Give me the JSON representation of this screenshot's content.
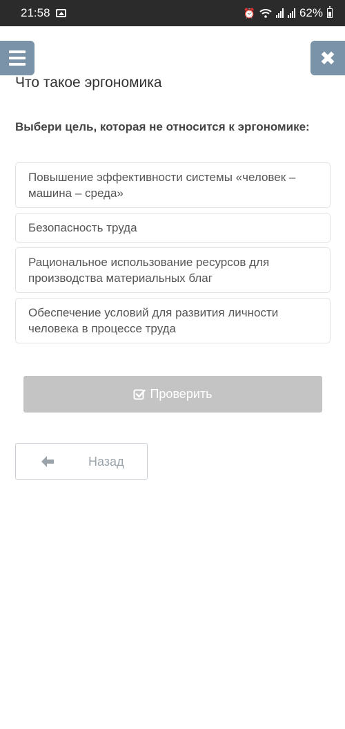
{
  "status_bar": {
    "time": "21:58",
    "battery": "62%",
    "icons": [
      "image-icon",
      "alarm-icon",
      "wifi-icon",
      "signal-icon",
      "signal-icon",
      "battery-icon"
    ]
  },
  "header": {
    "menu_icon": "hamburger-menu-icon",
    "close_icon": "close-icon",
    "title": "Что такое эргономика"
  },
  "question": {
    "text": "Выбери цель, которая не относится к эргономике:",
    "options": [
      "Повышение эффективности системы «человек – машина – среда»",
      "Безопасность труда",
      "Рациональное использование ресурсов для производства материальных благ",
      "Обеспечение условий для развития личности человека в процессе труда"
    ]
  },
  "actions": {
    "check_label": "Проверить",
    "check_icon": "checkbox-icon",
    "back_label": "Назад",
    "back_icon": "arrow-left-icon"
  },
  "colors": {
    "status_bar_bg": "#2b2b2b",
    "header_button_bg": "#7a93a8",
    "check_button_bg": "#c4c4c4",
    "option_border": "#dfe3e6"
  }
}
